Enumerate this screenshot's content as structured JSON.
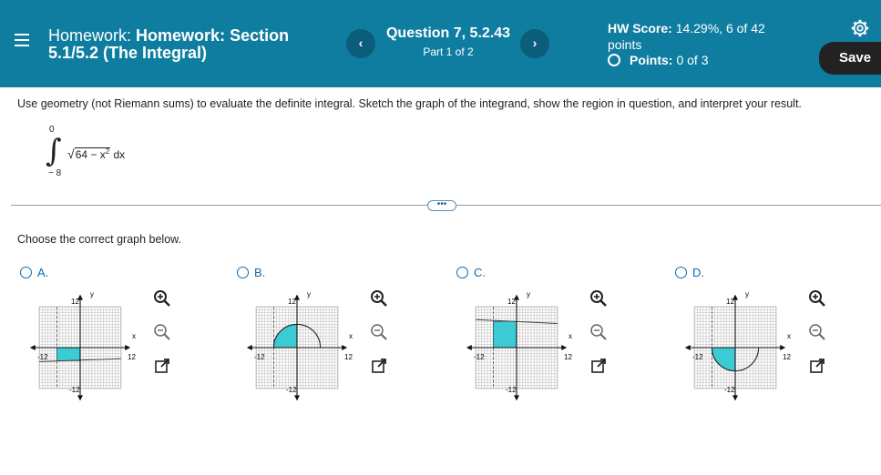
{
  "header": {
    "title_prefix": "Homework:",
    "title_bold": "Homework: Section 5.1/5.2 (The Integral)",
    "question_title": "Question 7, 5.2.43",
    "question_part": "Part 1 of 2",
    "score_label": "HW Score:",
    "score_value": "14.29%, 6 of 42 points",
    "points_label": "Points:",
    "points_value": "0 of 3",
    "save_label": "Save",
    "prev_glyph": "‹",
    "next_glyph": "›"
  },
  "problem": {
    "prompt": "Use geometry (not Riemann sums) to evaluate the definite integral. Sketch the graph of the integrand, show the region in question, and interpret your result.",
    "upper_limit": "0",
    "lower_limit": "− 8",
    "integrand": "64 − x",
    "exponent": "2",
    "differential": " dx"
  },
  "more_label": "•••",
  "choose_text": "Choose the correct graph below.",
  "options": [
    {
      "letter": "A.",
      "axis_y": "y",
      "axis_x": "x",
      "tick_pos": "12",
      "tick_neg": "-12"
    },
    {
      "letter": "B.",
      "axis_y": "y",
      "axis_x": "x",
      "tick_pos": "12",
      "tick_neg": "-12"
    },
    {
      "letter": "C.",
      "axis_y": "y",
      "axis_x": "x",
      "tick_pos": "12",
      "tick_neg": "-12"
    },
    {
      "letter": "D.",
      "axis_y": "y",
      "axis_x": "x",
      "tick_pos": "12",
      "tick_neg": "-12"
    }
  ],
  "colors": {
    "header_bg": "#0f7da0",
    "nav_btn": "#0a5e79",
    "save_bg": "#222222",
    "link_blue": "#0f6bb0",
    "region_fill": "#3ccad4"
  },
  "icons": [
    "menu-icon",
    "gear-icon",
    "zoom-in-icon",
    "zoom-out-icon",
    "expand-icon"
  ]
}
